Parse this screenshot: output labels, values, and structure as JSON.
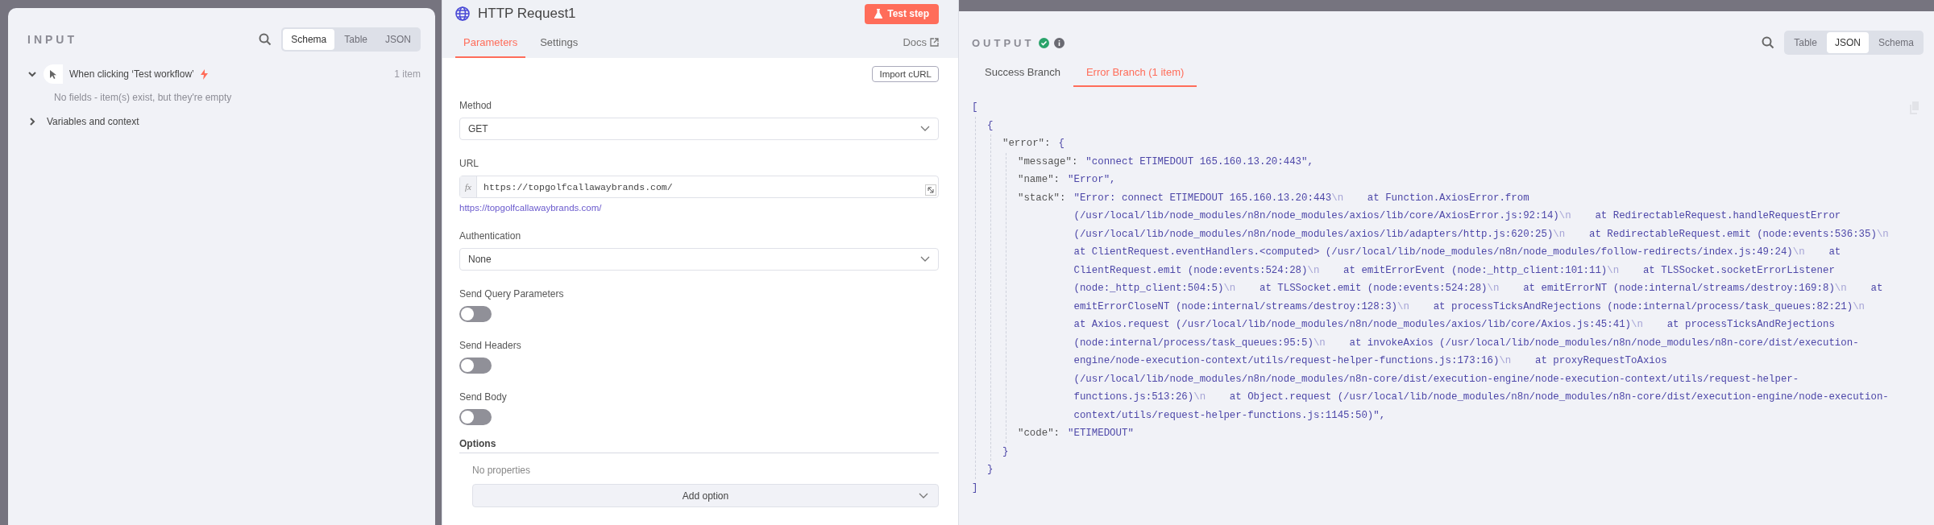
{
  "input_panel": {
    "title": "INPUT",
    "view_tabs": [
      {
        "label": "Schema",
        "selected": true
      },
      {
        "label": "Table",
        "selected": false
      },
      {
        "label": "JSON",
        "selected": false
      }
    ],
    "nodes": [
      {
        "name": "When clicking ‘Test workflow’",
        "count": "1 item",
        "expanded": true,
        "message": "No fields - item(s) exist, but they're empty"
      }
    ],
    "sections": [
      {
        "label": "Variables and context",
        "expanded": false
      }
    ]
  },
  "node_panel": {
    "title": "HTTP Request1",
    "test_button": "Test step",
    "tabs": [
      {
        "label": "Parameters",
        "selected": true
      },
      {
        "label": "Settings",
        "selected": false
      }
    ],
    "docs_link": "Docs",
    "import_button": "Import cURL",
    "fields": [
      {
        "kind": "select",
        "label": "Method",
        "value": "GET"
      },
      {
        "kind": "expression",
        "label": "URL",
        "prefix": "fx",
        "value": "https://topgolfcallawaybrands.com/",
        "preview": "https://topgolfcallawaybrands.com/"
      },
      {
        "kind": "select",
        "label": "Authentication",
        "value": "None"
      },
      {
        "kind": "toggle",
        "label": "Send Query Parameters",
        "on": false
      },
      {
        "kind": "toggle",
        "label": "Send Headers",
        "on": false
      },
      {
        "kind": "toggle",
        "label": "Send Body",
        "on": false
      }
    ],
    "options": {
      "title": "Options",
      "empty_text": "No properties",
      "add_button": "Add option"
    }
  },
  "output_panel": {
    "title": "OUTPUT",
    "view_tabs": [
      {
        "label": "Table",
        "selected": false
      },
      {
        "label": "JSON",
        "selected": true
      },
      {
        "label": "Schema",
        "selected": false
      }
    ],
    "branches": [
      {
        "label": "Success Branch",
        "selected": false
      },
      {
        "label": "Error Branch (1 item)",
        "selected": true
      }
    ],
    "json_view": {
      "open": "[",
      "close": "]",
      "children": [
        {
          "open": "{",
          "close": "}",
          "children": [
            {
              "key": "\"error\":",
              "open": "{",
              "close": "}",
              "children": [
                {
                  "key": "\"message\":",
                  "value": "\"connect ETIMEDOUT 165.160.13.20:443\","
                },
                {
                  "key": "\"name\":",
                  "value": "\"Error\","
                },
                {
                  "key": "\"stack\":",
                  "segments": [
                    {
                      "kind": "text",
                      "text": "\"Error: connect ETIMEDOUT 165.160.13.20:443"
                    },
                    {
                      "kind": "escape",
                      "text": "\\n"
                    },
                    {
                      "kind": "text",
                      "text": "    at Function.AxiosError.from (/usr/local/lib/node_modules/n8n/node_modules/axios/lib/core/AxiosError.js:92:14)"
                    },
                    {
                      "kind": "escape",
                      "text": "\\n"
                    },
                    {
                      "kind": "text",
                      "text": "    at RedirectableRequest.handleRequestError (/usr/local/lib/node_modules/n8n/node_modules/axios/lib/adapters/http.js:620:25)"
                    },
                    {
                      "kind": "escape",
                      "text": "\\n"
                    },
                    {
                      "kind": "text",
                      "text": "    at RedirectableRequest.emit (node:events:536:35)"
                    },
                    {
                      "kind": "escape",
                      "text": "\\n"
                    },
                    {
                      "kind": "text",
                      "text": "    at ClientRequest.eventHandlers.<computed> (/usr/local/lib/node_modules/n8n/node_modules/follow-redirects/index.js:49:24)"
                    },
                    {
                      "kind": "escape",
                      "text": "\\n"
                    },
                    {
                      "kind": "text",
                      "text": "    at ClientRequest.emit (node:events:524:28)"
                    },
                    {
                      "kind": "escape",
                      "text": "\\n"
                    },
                    {
                      "kind": "text",
                      "text": "    at emitErrorEvent (node:_http_client:101:11)"
                    },
                    {
                      "kind": "escape",
                      "text": "\\n"
                    },
                    {
                      "kind": "text",
                      "text": "    at TLSSocket.socketErrorListener (node:_http_client:504:5)"
                    },
                    {
                      "kind": "escape",
                      "text": "\\n"
                    },
                    {
                      "kind": "text",
                      "text": "    at TLSSocket.emit (node:events:524:28)"
                    },
                    {
                      "kind": "escape",
                      "text": "\\n"
                    },
                    {
                      "kind": "text",
                      "text": "    at emitErrorNT (node:internal/streams/destroy:169:8)"
                    },
                    {
                      "kind": "escape",
                      "text": "\\n"
                    },
                    {
                      "kind": "text",
                      "text": "    at emitErrorCloseNT (node:internal/streams/destroy:128:3)"
                    },
                    {
                      "kind": "escape",
                      "text": "\\n"
                    },
                    {
                      "kind": "text",
                      "text": "    at processTicksAndRejections (node:internal/process/task_queues:82:21)"
                    },
                    {
                      "kind": "escape",
                      "text": "\\n"
                    },
                    {
                      "kind": "text",
                      "text": "    at Axios.request (/usr/local/lib/node_modules/n8n/node_modules/axios/lib/core/Axios.js:45:41)"
                    },
                    {
                      "kind": "escape",
                      "text": "\\n"
                    },
                    {
                      "kind": "text",
                      "text": "    at processTicksAndRejections (node:internal/process/task_queues:95:5)"
                    },
                    {
                      "kind": "escape",
                      "text": "\\n"
                    },
                    {
                      "kind": "text",
                      "text": "    at invokeAxios (/usr/local/lib/node_modules/n8n/node_modules/n8n-core/dist/execution-engine/node-execution-context/utils/request-helper-functions.js:173:16)"
                    },
                    {
                      "kind": "escape",
                      "text": "\\n"
                    },
                    {
                      "kind": "text",
                      "text": "    at proxyRequestToAxios (/usr/local/lib/node_modules/n8n/node_modules/n8n-core/dist/execution-engine/node-execution-context/utils/request-helper-functions.js:513:26)"
                    },
                    {
                      "kind": "escape",
                      "text": "\\n"
                    },
                    {
                      "kind": "text",
                      "text": "    at Object.request (/usr/local/lib/node_modules/n8n/node_modules/n8n-core/dist/execution-engine/node-execution-context/utils/request-helper-functions.js:1145:50)\","
                    }
                  ]
                },
                {
                  "key": "\"code\":",
                  "value": "\"ETIMEDOUT\""
                }
              ]
            }
          ]
        }
      ]
    }
  }
}
